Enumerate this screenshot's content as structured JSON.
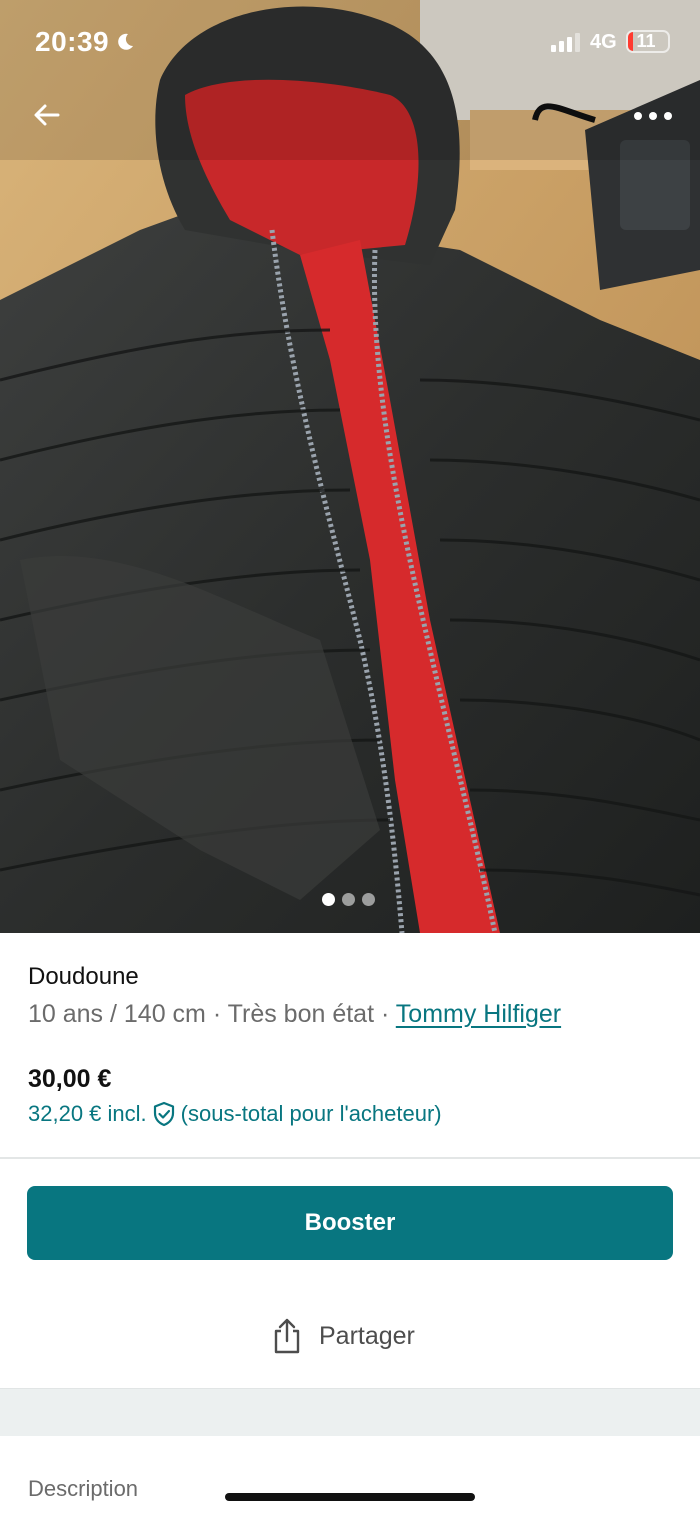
{
  "status_bar": {
    "time": "20:39",
    "network": "4G",
    "battery": "11"
  },
  "photo": {
    "pager_total": 3,
    "pager_active": 1
  },
  "item": {
    "title": "Doudoune",
    "size": "10 ans / 140 cm",
    "separator": " · ",
    "condition": "Très bon état",
    "brand": "Tommy Hilfiger",
    "price": "30,00 €",
    "price_incl": "32,20 € incl.",
    "price_incl_note": "(sous-total pour l'acheteur)"
  },
  "actions": {
    "booster_label": "Booster",
    "share_label": "Partager"
  },
  "sections": {
    "description_label": "Description"
  },
  "colors": {
    "accent": "#087680",
    "battery_low": "#ff3b30",
    "text_secondary": "#6b6b6b"
  },
  "icons": [
    "moon-icon",
    "signal-icon",
    "battery-icon",
    "back-arrow-icon",
    "more-options-icon",
    "shield-check-icon",
    "share-icon"
  ]
}
